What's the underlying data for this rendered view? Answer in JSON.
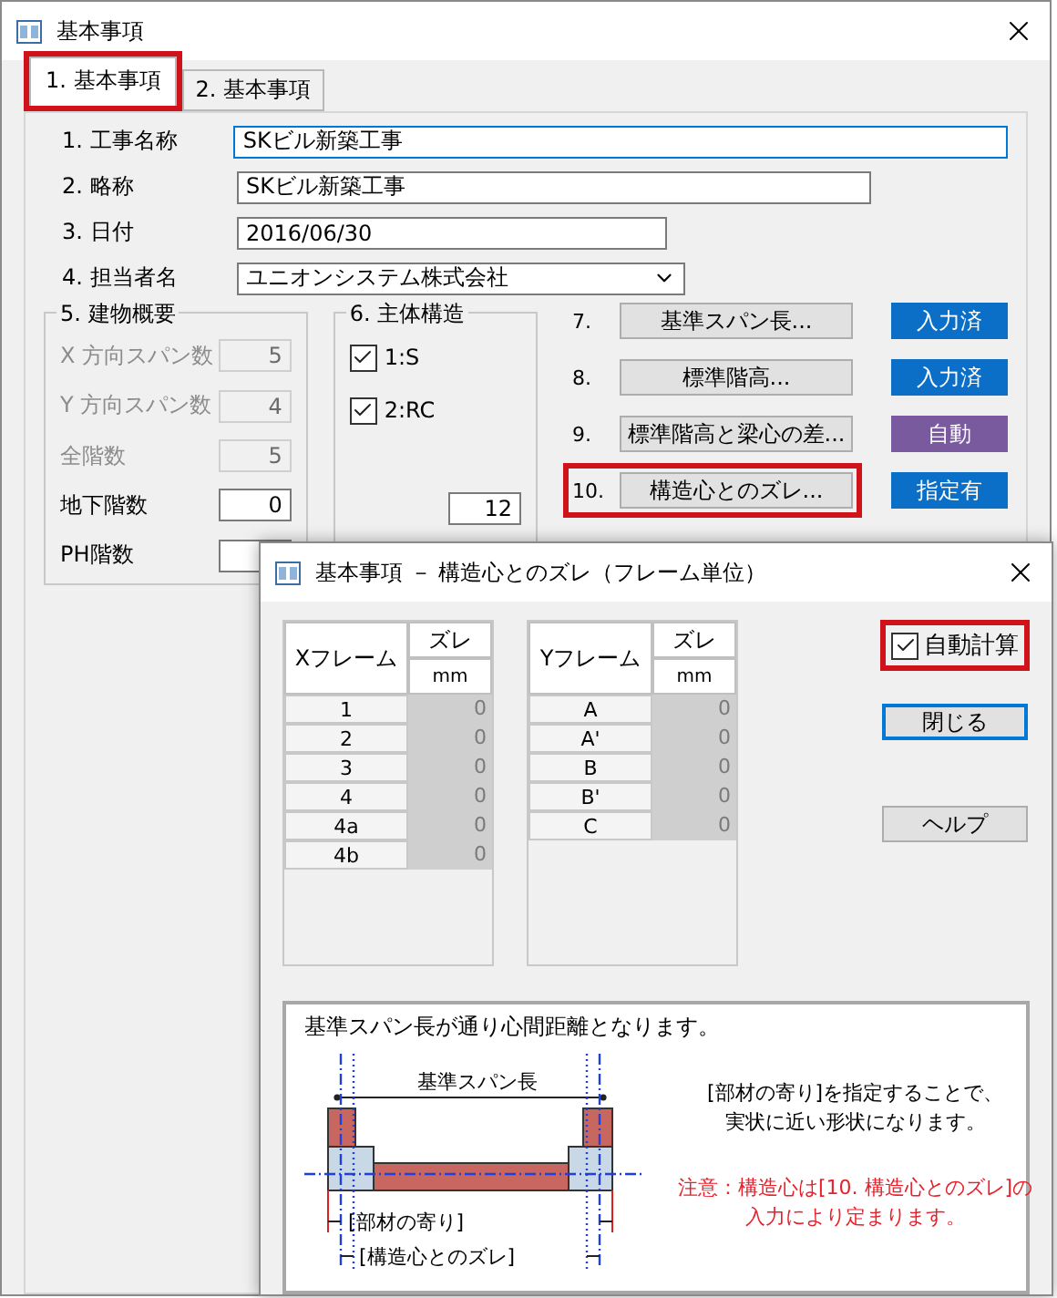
{
  "window": {
    "title": "基本事項"
  },
  "tabs": [
    {
      "label": "1. 基本事項",
      "selected": true,
      "highlighted": true
    },
    {
      "label": "2. 基本事項",
      "selected": false,
      "highlighted": false
    }
  ],
  "fields": [
    {
      "label": "1. 工事名称",
      "value": "SKビル新築工事",
      "kind": "text",
      "focused": true
    },
    {
      "label": "2. 略称",
      "value": "SKビル新築工事",
      "kind": "text",
      "focused": false
    },
    {
      "label": "3. 日付",
      "value": "2016/06/30",
      "kind": "text",
      "focused": false
    },
    {
      "label": "4. 担当者名",
      "value": "ユニオンシステム株式会社",
      "kind": "dropdown",
      "focused": false
    }
  ],
  "building": {
    "title": "5. 建物概要",
    "items": [
      {
        "label": "X 方向スパン数",
        "value": "5",
        "disabled": true
      },
      {
        "label": "Y 方向スパン数",
        "value": "4",
        "disabled": true
      },
      {
        "label": "全階数",
        "value": "5",
        "disabled": true
      },
      {
        "label": "地下階数",
        "value": "0",
        "disabled": false
      },
      {
        "label": "PH階数",
        "disabled": false
      }
    ]
  },
  "structure": {
    "title": "6. 主体構造",
    "checks": [
      {
        "label": "1:S",
        "checked": true
      },
      {
        "label": "2:RC",
        "checked": true
      }
    ],
    "value": "12"
  },
  "actions": [
    {
      "number": "7.",
      "label": "基準スパン長...",
      "status": "入力済",
      "color": "#0b6fc8",
      "highlighted": false
    },
    {
      "number": "8.",
      "label": "標準階高...",
      "status": "入力済",
      "color": "#0b6fc8",
      "highlighted": false
    },
    {
      "number": "9.",
      "label": "標準階高と梁心の差...",
      "status": "自動",
      "color": "#7a5a9e",
      "highlighted": false
    },
    {
      "number": "10.",
      "label": "構造心とのズレ...",
      "status": "指定有",
      "color": "#0b6fc8",
      "highlighted": true
    }
  ],
  "dialog": {
    "title": "基本事項 － 構造心とのズレ（フレーム単位）",
    "tables": [
      {
        "frame_header": "Xフレーム",
        "value_header": "ズレ",
        "unit": "mm",
        "disabled": true,
        "rows": [
          {
            "frame": "1",
            "value": "0"
          },
          {
            "frame": "2",
            "value": "0"
          },
          {
            "frame": "3",
            "value": "0"
          },
          {
            "frame": "4",
            "value": "0"
          },
          {
            "frame": "4a",
            "value": "0"
          },
          {
            "frame": "4b",
            "value": "0"
          }
        ]
      },
      {
        "frame_header": "Yフレーム",
        "value_header": "ズレ",
        "unit": "mm",
        "disabled": true,
        "rows": [
          {
            "frame": "A",
            "value": "0"
          },
          {
            "frame": "A'",
            "value": "0"
          },
          {
            "frame": "B",
            "value": "0"
          },
          {
            "frame": "B'",
            "value": "0"
          },
          {
            "frame": "C",
            "value": "0"
          }
        ]
      }
    ],
    "auto_calc": {
      "label": "自動計算",
      "checked": true,
      "highlighted": true
    },
    "buttons": [
      {
        "label": "閉じる",
        "default": true
      },
      {
        "label": "ヘルプ",
        "default": false
      }
    ],
    "info": {
      "heading": "基準スパン長が通り心間距離となります。",
      "span_label": "基準スパン長",
      "offset_label": "[部材の寄り]",
      "shift_label": "[構造心とのズレ]",
      "note": [
        "[部材の寄り]を指定することで、",
        "実状に近い形状になります。"
      ],
      "warning": [
        "注意：構造心は[10. 構造心とのズレ]の",
        "入力により定まります。"
      ]
    }
  }
}
